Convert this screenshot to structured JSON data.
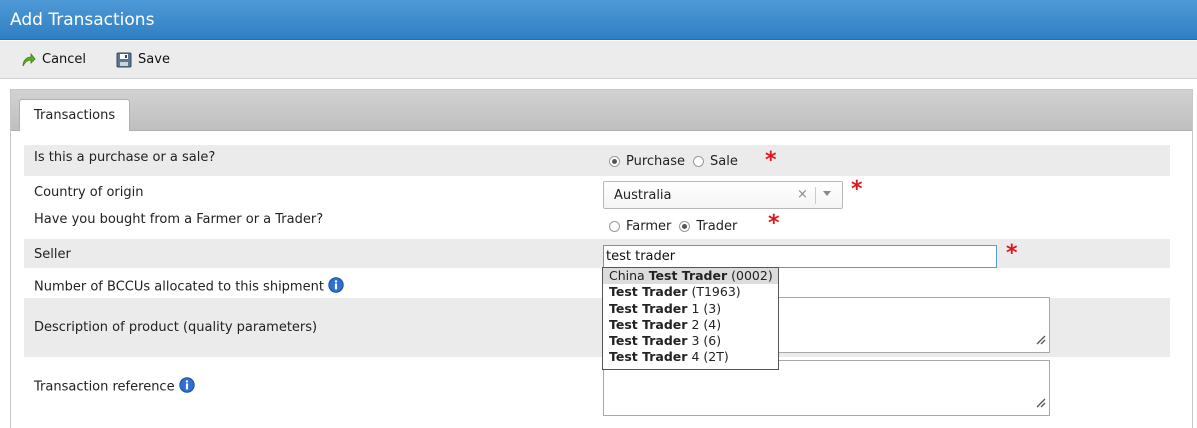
{
  "window": {
    "title": "Add Transactions"
  },
  "toolbar": {
    "cancel_label": "Cancel",
    "save_label": "Save"
  },
  "tabs": [
    {
      "label": "Transactions"
    }
  ],
  "form": {
    "purchase_or_sale": {
      "label": "Is this a purchase or a sale?",
      "options": [
        "Purchase",
        "Sale"
      ],
      "selected": "Purchase"
    },
    "country": {
      "label": "Country of origin",
      "value": "Australia",
      "clear_symbol": "×"
    },
    "farmer_or_trader": {
      "label": "Have you bought from a Farmer or a Trader?",
      "options": [
        "Farmer",
        "Trader"
      ],
      "selected": "Trader"
    },
    "seller": {
      "label": "Seller",
      "value": "test trader",
      "suggestions": [
        {
          "prefix": "China ",
          "match": "Test Trader",
          "suffix": " (0002)"
        },
        {
          "prefix": "",
          "match": "Test Trader",
          "suffix": " (T1963)"
        },
        {
          "prefix": "",
          "match": "Test Trader",
          "suffix": " 1 (3)"
        },
        {
          "prefix": "",
          "match": "Test Trader",
          "suffix": " 2 (4)"
        },
        {
          "prefix": "",
          "match": "Test Trader",
          "suffix": " 3 (6)"
        },
        {
          "prefix": "",
          "match": "Test Trader",
          "suffix": " 4 (2T)"
        }
      ]
    },
    "bccus": {
      "label": "Number of BCCUs allocated to this shipment"
    },
    "description": {
      "label": "Description of product (quality parameters)"
    },
    "reference": {
      "label": "Transaction reference"
    },
    "required_marker": "*"
  },
  "colors": {
    "title_bar": "#3b8bd0",
    "required": "#e0141b",
    "info": "#2f6fd0"
  }
}
